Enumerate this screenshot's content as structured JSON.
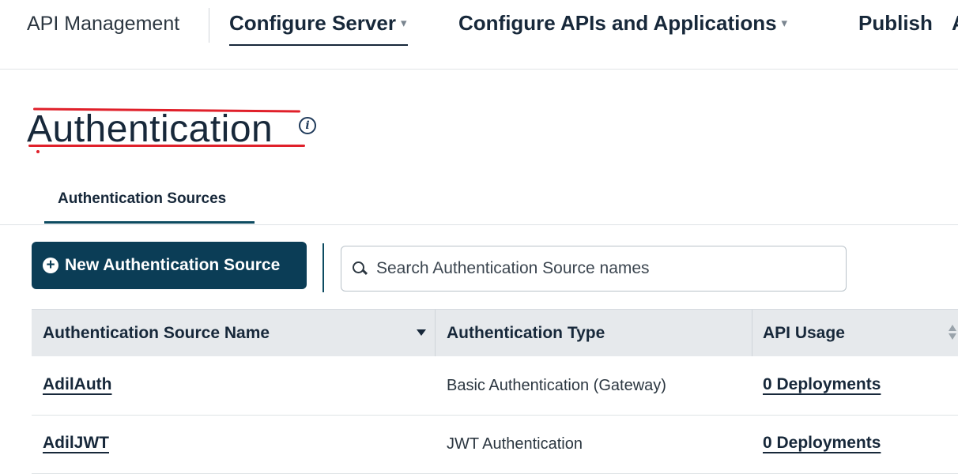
{
  "nav": {
    "brand": "API Management",
    "items": [
      {
        "label": "Configure Server",
        "has_caret": true,
        "active": true
      },
      {
        "label": "Configure APIs and Applications",
        "has_caret": true,
        "active": false
      },
      {
        "label": "Publish",
        "has_caret": false,
        "active": false
      },
      {
        "label": "A",
        "has_caret": false,
        "active": false
      }
    ],
    "caret": "▾"
  },
  "page": {
    "title": "Authentication",
    "info_icon": "info-icon",
    "info_glyph": "i"
  },
  "tabs": [
    {
      "label": "Authentication Sources",
      "active": true
    }
  ],
  "toolbar": {
    "new_button_label": "New Authentication Source",
    "new_button_icon": "plus-circle-icon",
    "search_placeholder": "Search Authentication Source names",
    "search_value": ""
  },
  "table": {
    "columns": [
      {
        "label": "Authentication Source Name",
        "sort": "descending"
      },
      {
        "label": "Authentication Type",
        "sort": "none"
      },
      {
        "label": "API Usage",
        "sort": "sortable"
      }
    ],
    "rows": [
      {
        "name": "AdilAuth",
        "type": "Basic Authentication (Gateway)",
        "usage": "0 Deployments"
      },
      {
        "name": "AdilJWT",
        "type": "JWT Authentication",
        "usage": "0 Deployments"
      }
    ]
  },
  "colors": {
    "primary": "#0b3d56",
    "annotation": "#e0202a",
    "header_bg": "#e6e9ec"
  }
}
